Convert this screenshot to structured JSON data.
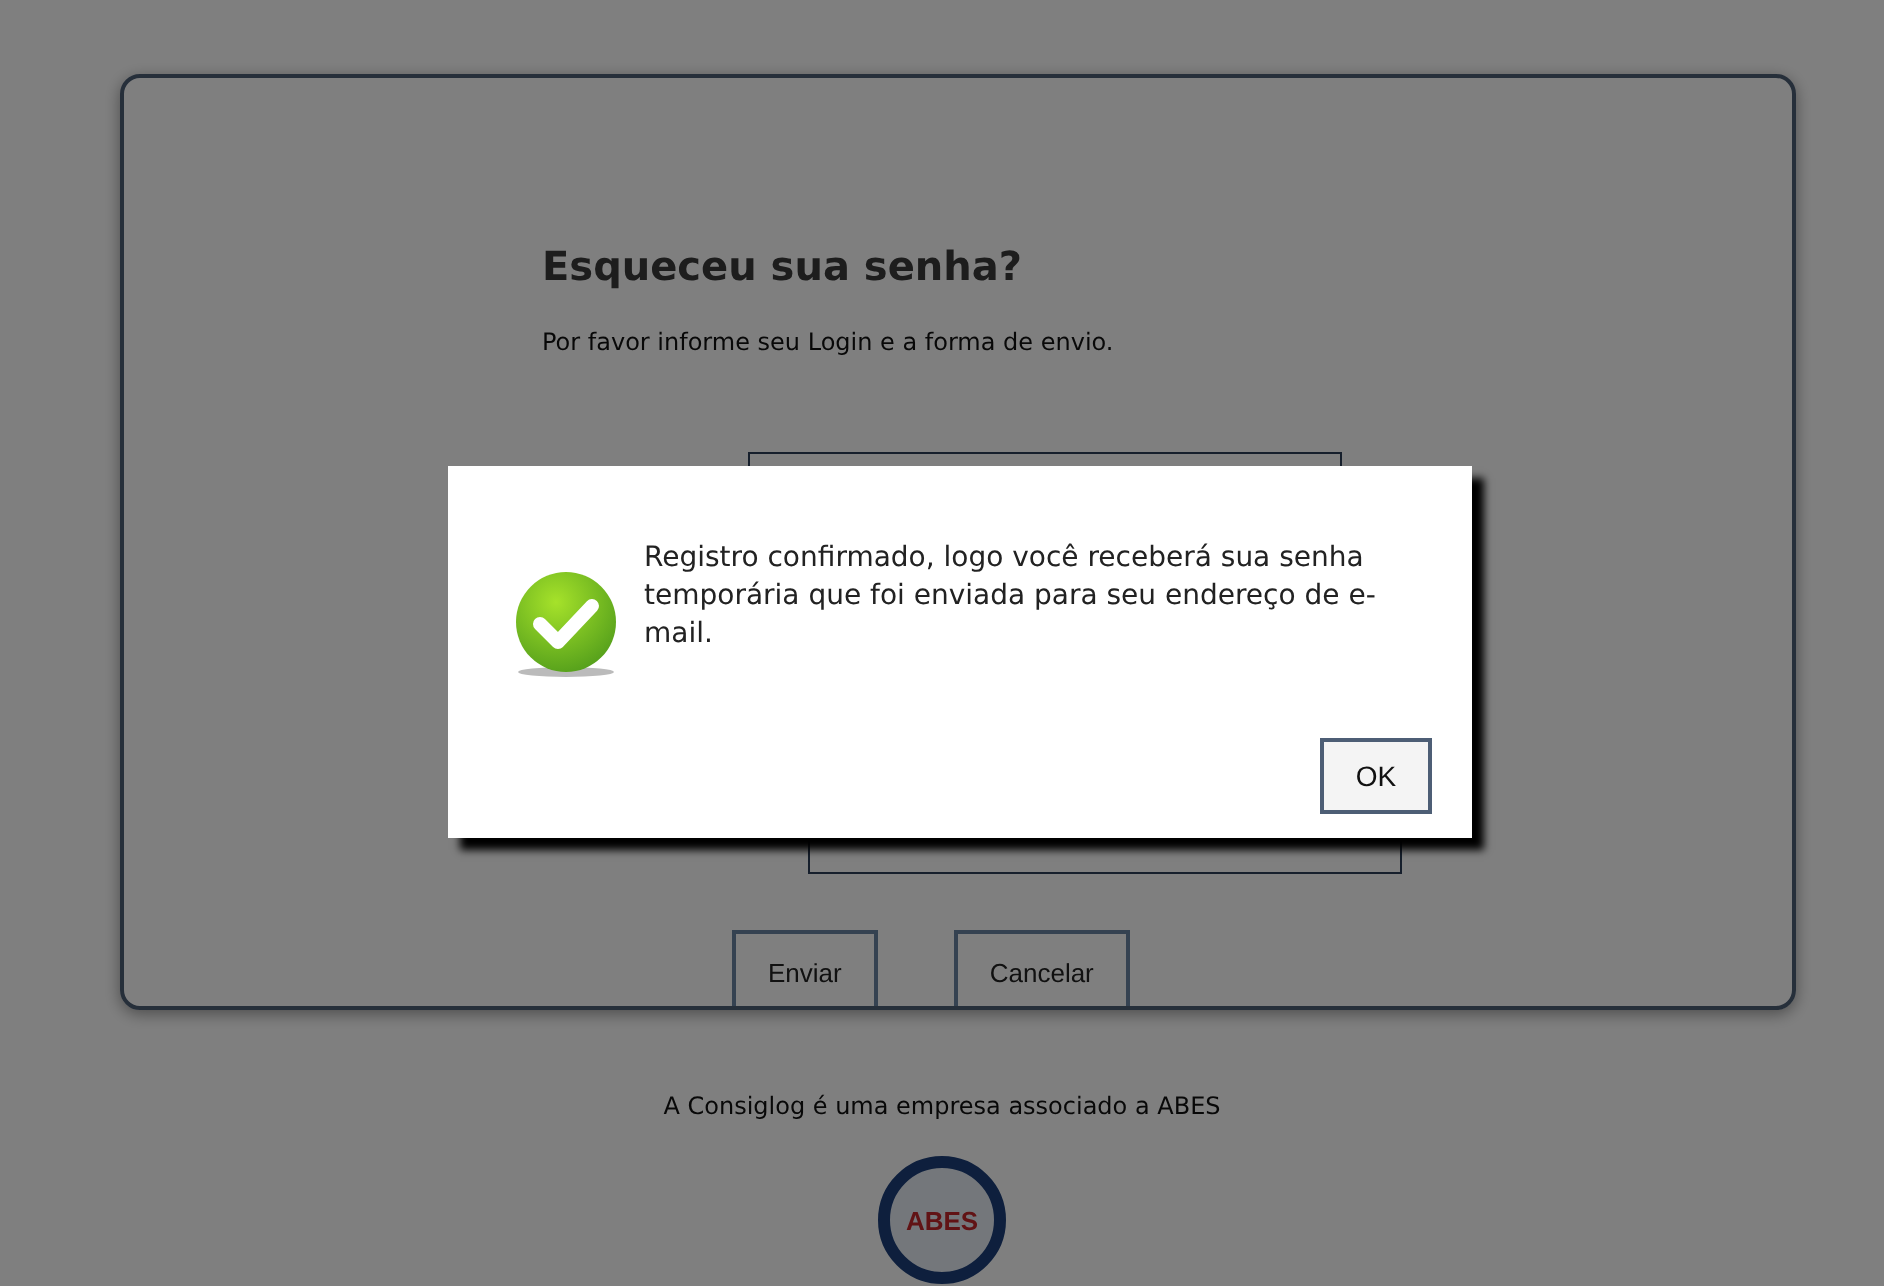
{
  "form": {
    "title": "Esqueceu sua senha?",
    "instruction": "Por favor informe seu Login e a forma de envio.",
    "buttons": [
      "Enviar",
      "Cancelar"
    ]
  },
  "footer": {
    "text": "A Consiglog é uma empresa associado a ABES",
    "logo_text": "ABES"
  },
  "dialog": {
    "message": "Registro confirmado, logo você receberá sua senha temporária que foi enviada para seu endereço de e-mail.",
    "button": "OK"
  }
}
